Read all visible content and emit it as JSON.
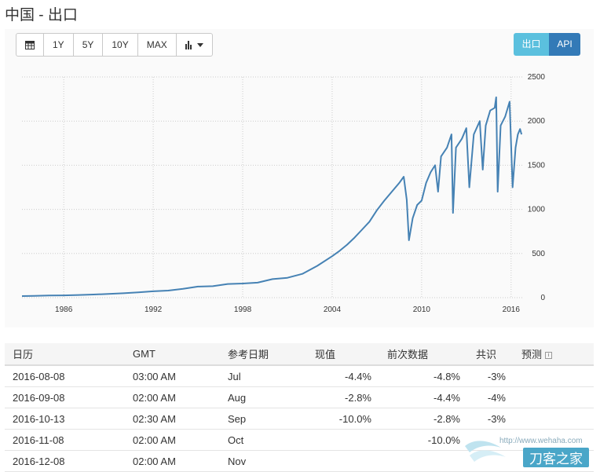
{
  "title": "中国 - 出口",
  "toolbar": {
    "calendar_icon": "calendar-icon",
    "b1y": "1Y",
    "b5y": "5Y",
    "b10y": "10Y",
    "bmax": "MAX",
    "chart_type_icon": "bar-chart-icon"
  },
  "buttons": {
    "export": "出口",
    "api": "API"
  },
  "colors": {
    "line": "#4682b4",
    "export_btn": "#5bc0de",
    "api_btn": "#337ab7"
  },
  "chart_data": {
    "type": "line",
    "title": "",
    "xlabel": "",
    "ylabel": "",
    "x_ticks": [
      "1986",
      "1992",
      "1998",
      "2004",
      "2010",
      "2016"
    ],
    "y_ticks": [
      "0",
      "500",
      "1000",
      "1500",
      "2000",
      "2500"
    ],
    "xlim": [
      1983.2,
      2016.8
    ],
    "ylim": [
      0,
      2500
    ],
    "grid": true,
    "y_axis_position": "right",
    "series": [
      {
        "values": [
          [
            1983.2,
            18
          ],
          [
            1984.0,
            20
          ],
          [
            1985.0,
            24
          ],
          [
            1986.0,
            26
          ],
          [
            1987.0,
            30
          ],
          [
            1988.0,
            36
          ],
          [
            1989.0,
            42
          ],
          [
            1990.0,
            50
          ],
          [
            1991.0,
            60
          ],
          [
            1992.0,
            72
          ],
          [
            1993.0,
            80
          ],
          [
            1994.0,
            100
          ],
          [
            1995.0,
            125
          ],
          [
            1996.0,
            130
          ],
          [
            1997.0,
            155
          ],
          [
            1998.0,
            160
          ],
          [
            1999.0,
            170
          ],
          [
            2000.0,
            210
          ],
          [
            2001.0,
            225
          ],
          [
            2002.0,
            270
          ],
          [
            2003.0,
            360
          ],
          [
            2004.0,
            470
          ],
          [
            2004.5,
            530
          ],
          [
            2005.0,
            600
          ],
          [
            2005.5,
            680
          ],
          [
            2006.0,
            770
          ],
          [
            2006.5,
            860
          ],
          [
            2007.0,
            990
          ],
          [
            2007.5,
            1100
          ],
          [
            2008.0,
            1200
          ],
          [
            2008.5,
            1300
          ],
          [
            2008.8,
            1370
          ],
          [
            2009.0,
            1110
          ],
          [
            2009.15,
            650
          ],
          [
            2009.4,
            900
          ],
          [
            2009.7,
            1050
          ],
          [
            2010.0,
            1100
          ],
          [
            2010.3,
            1300
          ],
          [
            2010.6,
            1420
          ],
          [
            2010.9,
            1500
          ],
          [
            2011.1,
            1200
          ],
          [
            2011.3,
            1600
          ],
          [
            2011.7,
            1700
          ],
          [
            2012.0,
            1850
          ],
          [
            2012.1,
            960
          ],
          [
            2012.3,
            1700
          ],
          [
            2012.7,
            1800
          ],
          [
            2013.0,
            1920
          ],
          [
            2013.2,
            1250
          ],
          [
            2013.5,
            1850
          ],
          [
            2013.9,
            2000
          ],
          [
            2014.1,
            1450
          ],
          [
            2014.3,
            1950
          ],
          [
            2014.6,
            2120
          ],
          [
            2014.9,
            2150
          ],
          [
            2015.0,
            2270
          ],
          [
            2015.1,
            1200
          ],
          [
            2015.3,
            1950
          ],
          [
            2015.6,
            2050
          ],
          [
            2015.9,
            2220
          ],
          [
            2016.1,
            1250
          ],
          [
            2016.3,
            1700
          ],
          [
            2016.45,
            1850
          ],
          [
            2016.6,
            1910
          ],
          [
            2016.7,
            1850
          ]
        ]
      }
    ]
  },
  "table": {
    "headers": [
      "日历",
      "GMT",
      "参考日期",
      "现值",
      "前次数据",
      "共识",
      "预测"
    ],
    "rows": [
      [
        "2016-08-08",
        "03:00 AM",
        "Jul",
        "-4.4%",
        "-4.8%",
        "-3%",
        ""
      ],
      [
        "2016-09-08",
        "02:00 AM",
        "Aug",
        "-2.8%",
        "-4.4%",
        "-4%",
        ""
      ],
      [
        "2016-10-13",
        "02:30 AM",
        "Sep",
        "-10.0%",
        "-2.8%",
        "-3%",
        ""
      ],
      [
        "2016-11-08",
        "02:00 AM",
        "Oct",
        "",
        "-10.0%",
        "",
        ""
      ],
      [
        "2016-12-08",
        "02:00 AM",
        "Nov",
        "",
        "",
        "",
        ""
      ]
    ]
  },
  "watermark": {
    "url": "http://www.wehaha.com",
    "text": "刀客之家"
  }
}
